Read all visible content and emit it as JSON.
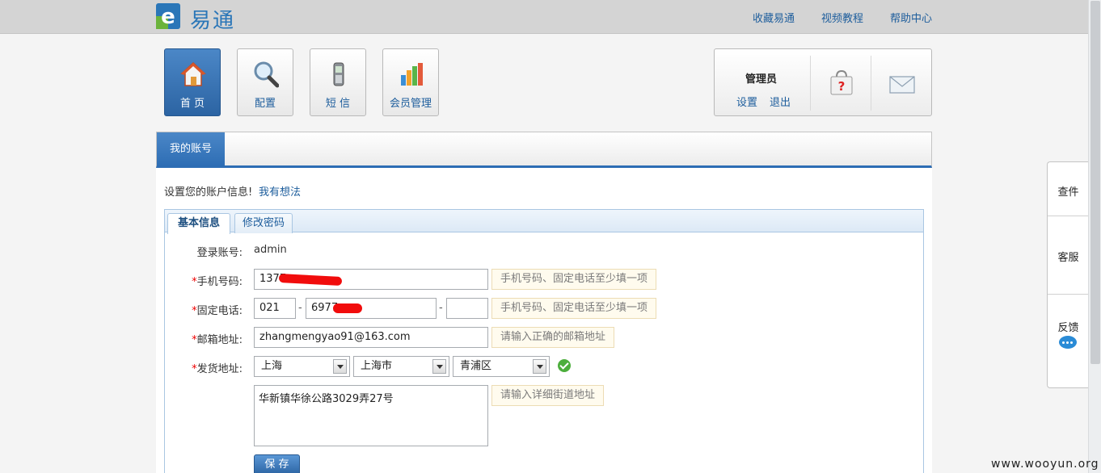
{
  "brand": {
    "name": "易通"
  },
  "top_links": [
    "收藏易通",
    "视频教程",
    "帮助中心"
  ],
  "nav": [
    {
      "label": "首 页",
      "icon": "home-icon",
      "active": true
    },
    {
      "label": "配置",
      "icon": "search-icon",
      "active": false
    },
    {
      "label": "短 信",
      "icon": "phone-icon",
      "active": false
    },
    {
      "label": "会员管理",
      "icon": "bar-chart-icon",
      "active": false
    }
  ],
  "user": {
    "name": "管理员",
    "settings": "设置",
    "logout": "退出"
  },
  "page_tab": "我的账号",
  "intro": {
    "text": "设置您的账户信息!",
    "link": "我有想法"
  },
  "form_tabs": [
    "基本信息",
    "修改密码"
  ],
  "form": {
    "login_label": "登录账号:",
    "login_value": "admin",
    "mobile_label": "手机号码:",
    "mobile_value": "1377",
    "mobile_hint": "手机号码、固定电话至少填一项",
    "phone_label": "固定电话:",
    "phone_area": "021",
    "phone_number": "6977",
    "phone_ext": "",
    "phone_hint": "手机号码、固定电话至少填一项",
    "email_label": "邮箱地址:",
    "email_value": "zhangmengyao91@163.com",
    "email_hint": "请输入正确的邮箱地址",
    "address_label": "发货地址:",
    "province": "上海",
    "city": "上海市",
    "district": "青浦区",
    "street": "华新镇华徐公路3029弄27号",
    "street_hint": "请输入详细街道地址",
    "required_mark": "*",
    "save": "保 存"
  },
  "side": [
    "查件",
    "客服",
    "反馈"
  ],
  "watermark": "www.wooyun.org",
  "colors": {
    "accent": "#2d6db4",
    "link": "#1d5d9c",
    "required": "#e00000",
    "redaction": "#f10c0c"
  }
}
